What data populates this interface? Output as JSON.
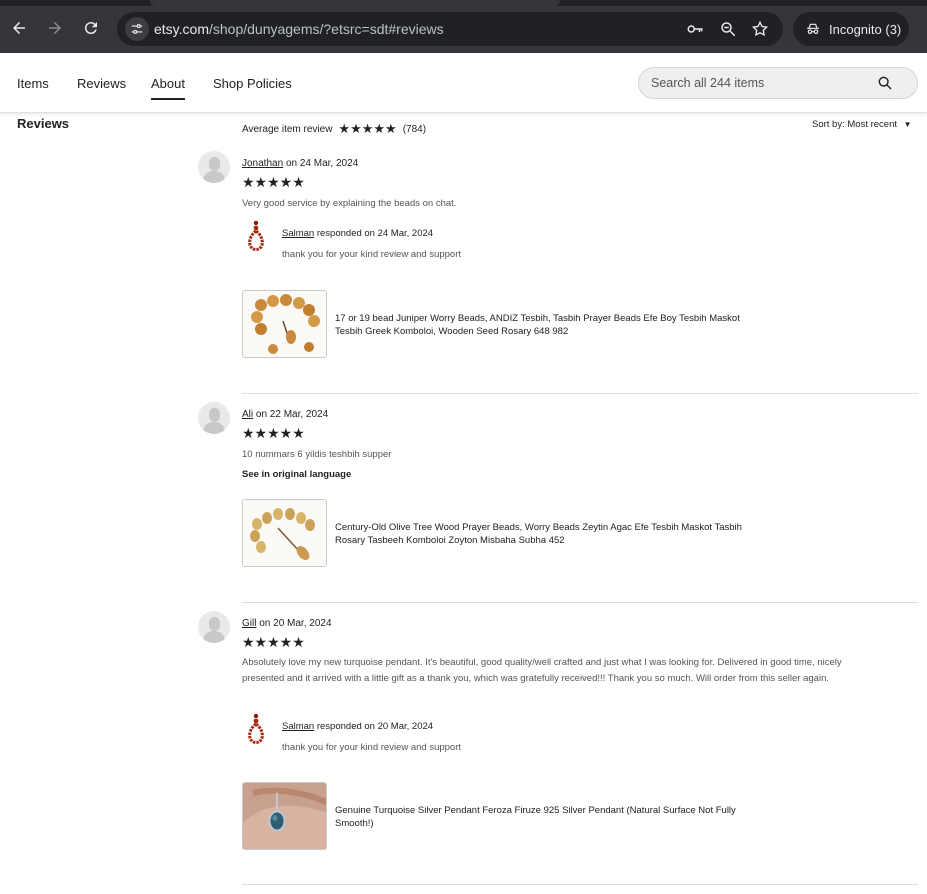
{
  "browser": {
    "url_domain": "etsy.com",
    "url_path": "/shop/dunyagems/?etsrc=sdt#reviews",
    "incognito_label": "Incognito (3)"
  },
  "shop_nav": {
    "tabs": [
      "Items",
      "Reviews",
      "About",
      "Shop Policies"
    ],
    "active_tab": "About",
    "search_placeholder": "Search all 244 items"
  },
  "reviews_section": {
    "heading": "Reviews",
    "average_label": "Average item review",
    "average_stars": "★★★★★",
    "count": "(784)",
    "sort_label": "Sort by: Most recent"
  },
  "reviews": [
    {
      "name": "Jonathan",
      "date": "on 24 Mar, 2024",
      "stars": "★★★★★",
      "text": "Very good service by explaining the beads on chat.",
      "response": {
        "name": "Salman",
        "date": "responded on 24 Mar, 2024",
        "text": "thank you for your kind review and support"
      },
      "item_title": "17 or 19 bead Juniper Worry Beads, ANDIZ Tesbih, Tasbih Prayer Beads Efe Boy Tesbih Maskot Tesbih Greek Komboloi, Wooden Seed Rosary 648 982"
    },
    {
      "name": "Ali",
      "date": "on 22 Mar, 2024",
      "stars": "★★★★★",
      "text": "10 nummars 6 yildis teshbih supper",
      "see_original": "See in original language",
      "item_title": "Century-Old Olive Tree Wood Prayer Beads, Worry Beads Zeytin Agac Efe Tesbih Maskot Tasbih Rosary Tasbeeh Komboloi Zoyton Misbaha Subha 452"
    },
    {
      "name": "Gill",
      "date": "on 20 Mar, 2024",
      "stars": "★★★★★",
      "text": "Absolutely love my new turquoise pendant. It's beautiful, good quality/well crafted and just what I was looking for. Delivered in good time, nicely presented and it arrived with a little gift as a thank you, which was gratefully received!!! Thank you so much. Will order from this seller again.",
      "response": {
        "name": "Salman",
        "date": "responded on 20 Mar, 2024",
        "text": "thank you for your kind review and support"
      },
      "item_title": "Genuine Turquoise Silver Pendant Feroza Firuze 925 Silver Pendant (Natural Surface Not Fully Smooth!)"
    }
  ],
  "colors": {
    "chrome_bg": "#35363a",
    "omnibox_bg": "#202124",
    "text": "#222222"
  }
}
